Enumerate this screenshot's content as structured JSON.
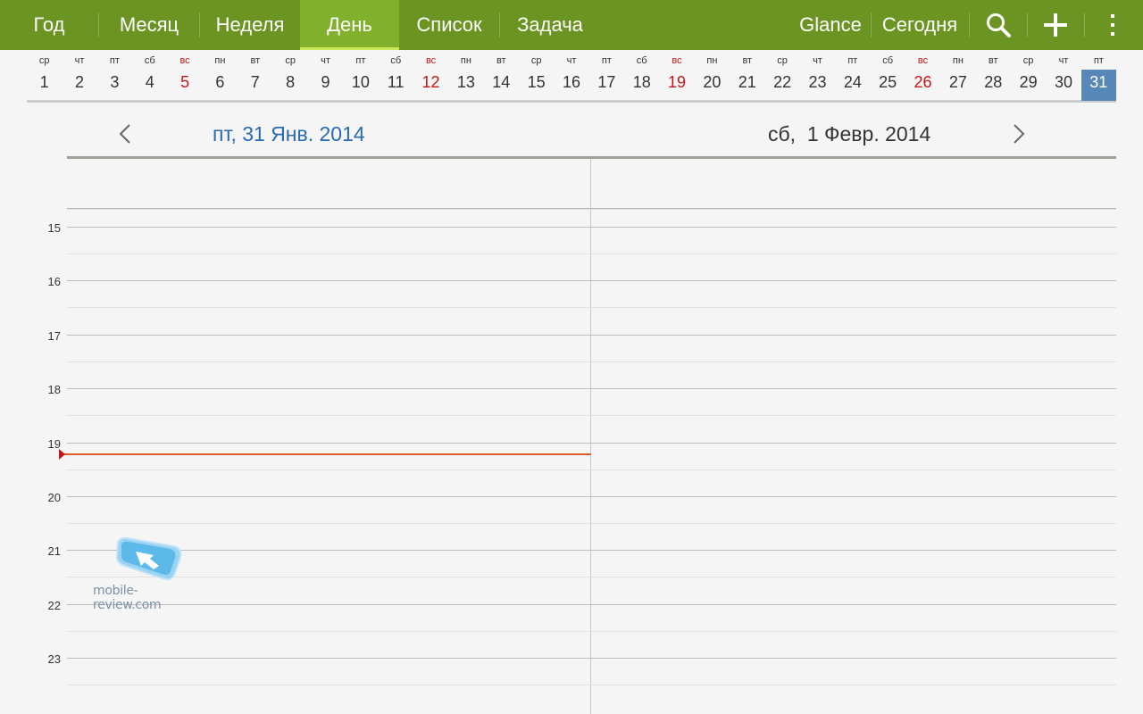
{
  "tabs": [
    {
      "label": "Год",
      "active": false
    },
    {
      "label": "Месяц",
      "active": false
    },
    {
      "label": "Неделя",
      "active": false
    },
    {
      "label": "День",
      "active": true
    },
    {
      "label": "Список",
      "active": false
    },
    {
      "label": "Задача",
      "active": false
    }
  ],
  "actions": {
    "glance": "Glance",
    "today": "Сегодня",
    "search_icon": "search-icon",
    "add_icon": "plus-icon",
    "menu_icon": "overflow-menu-icon"
  },
  "colors": {
    "bar": "#6b9422",
    "active_tab": "#80b02c",
    "sunday": "#c41616",
    "selected_day": "#5888b8",
    "today_header": "#2a6ab0",
    "now_line": "#e05a2e"
  },
  "day_strip": [
    {
      "dow": "ср",
      "num": "1"
    },
    {
      "dow": "чт",
      "num": "2"
    },
    {
      "dow": "пт",
      "num": "3"
    },
    {
      "dow": "сб",
      "num": "4"
    },
    {
      "dow": "вс",
      "num": "5",
      "sunday": true
    },
    {
      "dow": "пн",
      "num": "6"
    },
    {
      "dow": "вт",
      "num": "7"
    },
    {
      "dow": "ср",
      "num": "8"
    },
    {
      "dow": "чт",
      "num": "9"
    },
    {
      "dow": "пт",
      "num": "10"
    },
    {
      "dow": "сб",
      "num": "11"
    },
    {
      "dow": "вс",
      "num": "12",
      "sunday": true
    },
    {
      "dow": "пн",
      "num": "13"
    },
    {
      "dow": "вт",
      "num": "14"
    },
    {
      "dow": "ср",
      "num": "15"
    },
    {
      "dow": "чт",
      "num": "16"
    },
    {
      "dow": "пт",
      "num": "17"
    },
    {
      "dow": "сб",
      "num": "18"
    },
    {
      "dow": "вс",
      "num": "19",
      "sunday": true
    },
    {
      "dow": "пн",
      "num": "20"
    },
    {
      "dow": "вт",
      "num": "21"
    },
    {
      "dow": "ср",
      "num": "22"
    },
    {
      "dow": "чт",
      "num": "23"
    },
    {
      "dow": "пт",
      "num": "24"
    },
    {
      "dow": "сб",
      "num": "25"
    },
    {
      "dow": "вс",
      "num": "26",
      "sunday": true
    },
    {
      "dow": "пн",
      "num": "27"
    },
    {
      "dow": "вт",
      "num": "28"
    },
    {
      "dow": "ср",
      "num": "29"
    },
    {
      "dow": "чт",
      "num": "30"
    },
    {
      "dow": "пт",
      "num": "31",
      "selected": true
    }
  ],
  "days": {
    "left": "пт, 31 Янв. 2014",
    "right": "сб,  1 Февр. 2014",
    "prev_icon": "chevron-left-icon",
    "next_icon": "chevron-right-icon"
  },
  "hours": [
    "15",
    "16",
    "17",
    "18",
    "19",
    "20",
    "21",
    "22",
    "23"
  ],
  "watermark": {
    "text": "mobile-review.com",
    "logo_icon": "mobile-review-logo"
  }
}
